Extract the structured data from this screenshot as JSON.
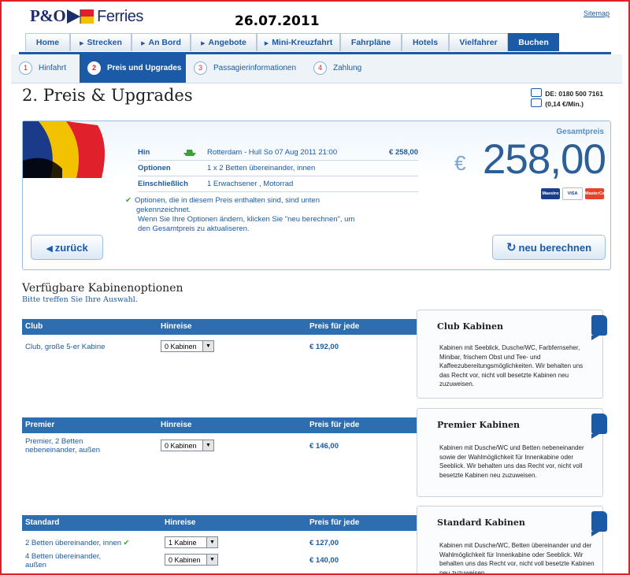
{
  "header": {
    "logo_text": "P&O",
    "logo_suffix": "Ferries",
    "date": "26.07.2011",
    "sitemap": "Sitemap"
  },
  "nav": {
    "tabs": [
      {
        "label": "Home"
      },
      {
        "label": "Strecken"
      },
      {
        "label": "An Bord"
      },
      {
        "label": "Angebote"
      },
      {
        "label": "Mini-Kreuzfahrt"
      },
      {
        "label": "Fahrpläne"
      },
      {
        "label": "Hotels"
      },
      {
        "label": "Vielfahrer"
      },
      {
        "label": "Buchen"
      }
    ]
  },
  "steps": [
    {
      "num": "1",
      "label": "Hinfahrt"
    },
    {
      "num": "2",
      "label": "Preis und Upgrades"
    },
    {
      "num": "3",
      "label": "Passagierinformationen"
    },
    {
      "num": "4",
      "label": "Zahlung"
    }
  ],
  "page_title": "2. Preis & Upgrades",
  "contact": {
    "phone": "DE: 0180 500 7161",
    "rate": "(0,14 €/Min.)"
  },
  "summary": {
    "rows": [
      {
        "key": "Hin",
        "value": "Rotterdam - Hull So 07 Aug 2011 21:00",
        "price": "€ 258,00"
      },
      {
        "key": "Optionen",
        "value": "1 x 2 Betten übereinander, innen",
        "price": ""
      },
      {
        "key": "Einschließlich",
        "value": "1 Erwachsener , Motorrad",
        "price": ""
      }
    ],
    "note_line1": "Optionen, die in diesem Preis enthalten sind, sind unten gekennzeichnet.",
    "note_line2": "Wenn Sie Ihre Optionen ändern, klicken Sie \"neu berechnen\", um den Gesamtpreis zu aktualiseren.",
    "total_label": "Gesamtpreis",
    "currency": "€",
    "total": "258,00",
    "cards": [
      "Maestro",
      "VISA",
      "MasterCard"
    ],
    "back_button": "zurück",
    "recalc_button": "neu berechnen"
  },
  "cabins": {
    "title": "Verfügbare Kabinenoptionen",
    "subtitle": "Bitte treffen Sie Ihre Auswahl.",
    "col_outbound": "Hinreise",
    "col_price": "Preis für jede",
    "groups": [
      {
        "name": "Club",
        "items": [
          {
            "name": "Club, große 5-er Kabine",
            "select": "0 Kabinen",
            "price": "€ 192,00"
          }
        ],
        "info_title": "Club Kabinen",
        "info_text": "Kabinen mit Seeblick, Dusche/WC, Farbfernseher, Minibar, frischem Obst und Tee- und Kaffeezubereitungsmöglichkeiten. Wir behalten uns das Recht vor, nicht voll besetzte Kabinen neu zuzuweisen."
      },
      {
        "name": "Premier",
        "items": [
          {
            "name": "Premier, 2 Betten nebeneinander, außen",
            "select": "0 Kabinen",
            "price": "€ 146,00"
          }
        ],
        "info_title": "Premier Kabinen",
        "info_text": "Kabinen mit Dusche/WC und Betten nebeneinander sowie der Wahlmöglichkeit für Innenkabine oder Seeblick. Wir behalten uns das Recht vor, nicht voll besetzte Kabinen neu zuzuweisen."
      },
      {
        "name": "Standard",
        "items": [
          {
            "name": "2 Betten übereinander, innen",
            "select": "1 Kabine",
            "price": "€ 127,00"
          },
          {
            "name": "4 Betten übereinander, außen",
            "select": "0 Kabinen",
            "price": "€ 140,00"
          }
        ],
        "info_title": "Standard Kabinen",
        "info_text": "Kabinen mit Dusche/WC, Betten übereinander und der Wahlmöglichkeit für Innenkabine oder Seeblick. Wir behalten uns das Recht vor, nicht voll besetzte Kabinen neu zuzuweisen."
      }
    ]
  }
}
